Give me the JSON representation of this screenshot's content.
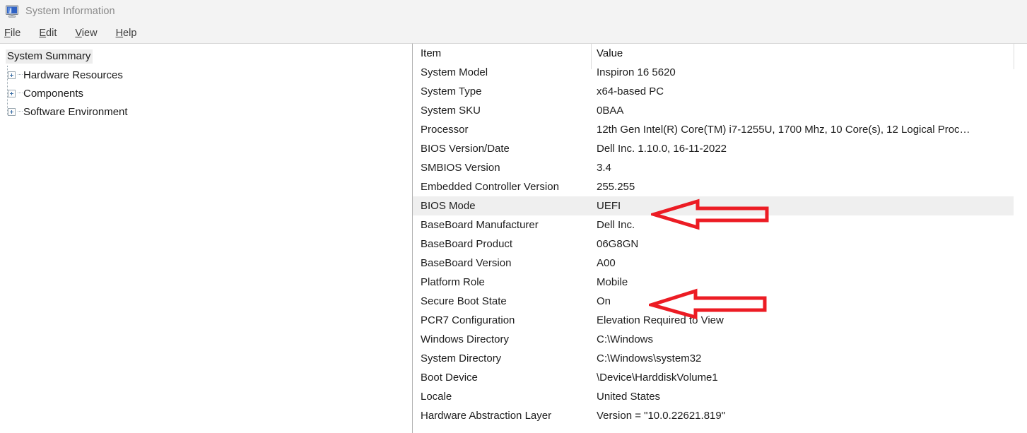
{
  "window": {
    "title": "System Information",
    "icon": "computer-monitor-icon"
  },
  "menu": {
    "items": [
      {
        "label": "File",
        "accel": "F",
        "rest": "ile"
      },
      {
        "label": "Edit",
        "accel": "E",
        "rest": "dit"
      },
      {
        "label": "View",
        "accel": "V",
        "rest": "iew"
      },
      {
        "label": "Help",
        "accel": "H",
        "rest": "elp"
      }
    ]
  },
  "sidebar": {
    "root": {
      "label": "System Summary",
      "selected": true
    },
    "items": [
      {
        "label": "Hardware Resources",
        "expander": "plus-icon"
      },
      {
        "label": "Components",
        "expander": "plus-icon"
      },
      {
        "label": "Software Environment",
        "expander": "plus-icon"
      }
    ]
  },
  "table": {
    "headers": {
      "item": "Item",
      "value": "Value"
    },
    "rows": [
      {
        "item": "System Model",
        "value": "Inspiron 16 5620",
        "highlighted": false
      },
      {
        "item": "System Type",
        "value": "x64-based PC",
        "highlighted": false
      },
      {
        "item": "System SKU",
        "value": "0BAA",
        "highlighted": false
      },
      {
        "item": "Processor",
        "value": "12th Gen Intel(R) Core(TM) i7-1255U, 1700 Mhz, 10 Core(s), 12 Logical Proc…",
        "highlighted": false
      },
      {
        "item": "BIOS Version/Date",
        "value": "Dell Inc. 1.10.0, 16-11-2022",
        "highlighted": false
      },
      {
        "item": "SMBIOS Version",
        "value": "3.4",
        "highlighted": false
      },
      {
        "item": "Embedded Controller Version",
        "value": "255.255",
        "highlighted": false
      },
      {
        "item": "BIOS Mode",
        "value": "UEFI",
        "highlighted": true
      },
      {
        "item": "BaseBoard Manufacturer",
        "value": "Dell Inc.",
        "highlighted": false
      },
      {
        "item": "BaseBoard Product",
        "value": "06G8GN",
        "highlighted": false
      },
      {
        "item": "BaseBoard Version",
        "value": "A00",
        "highlighted": false
      },
      {
        "item": "Platform Role",
        "value": "Mobile",
        "highlighted": false
      },
      {
        "item": "Secure Boot State",
        "value": "On",
        "highlighted": false
      },
      {
        "item": "PCR7 Configuration",
        "value": "Elevation Required to View",
        "highlighted": false
      },
      {
        "item": "Windows Directory",
        "value": "C:\\Windows",
        "highlighted": false
      },
      {
        "item": "System Directory",
        "value": "C:\\Windows\\system32",
        "highlighted": false
      },
      {
        "item": "Boot Device",
        "value": "\\Device\\HarddiskVolume1",
        "highlighted": false
      },
      {
        "item": "Locale",
        "value": "United States",
        "highlighted": false
      },
      {
        "item": "Hardware Abstraction Layer",
        "value": "Version = \"10.0.22621.819\"",
        "highlighted": false
      }
    ]
  },
  "annotations": {
    "color": "#ec1c24",
    "arrows": [
      {
        "name": "arrow-pointing-to-bios-mode",
        "target": "BIOS Mode"
      },
      {
        "name": "arrow-pointing-to-secure-boot-state",
        "target": "Secure Boot State"
      }
    ]
  }
}
